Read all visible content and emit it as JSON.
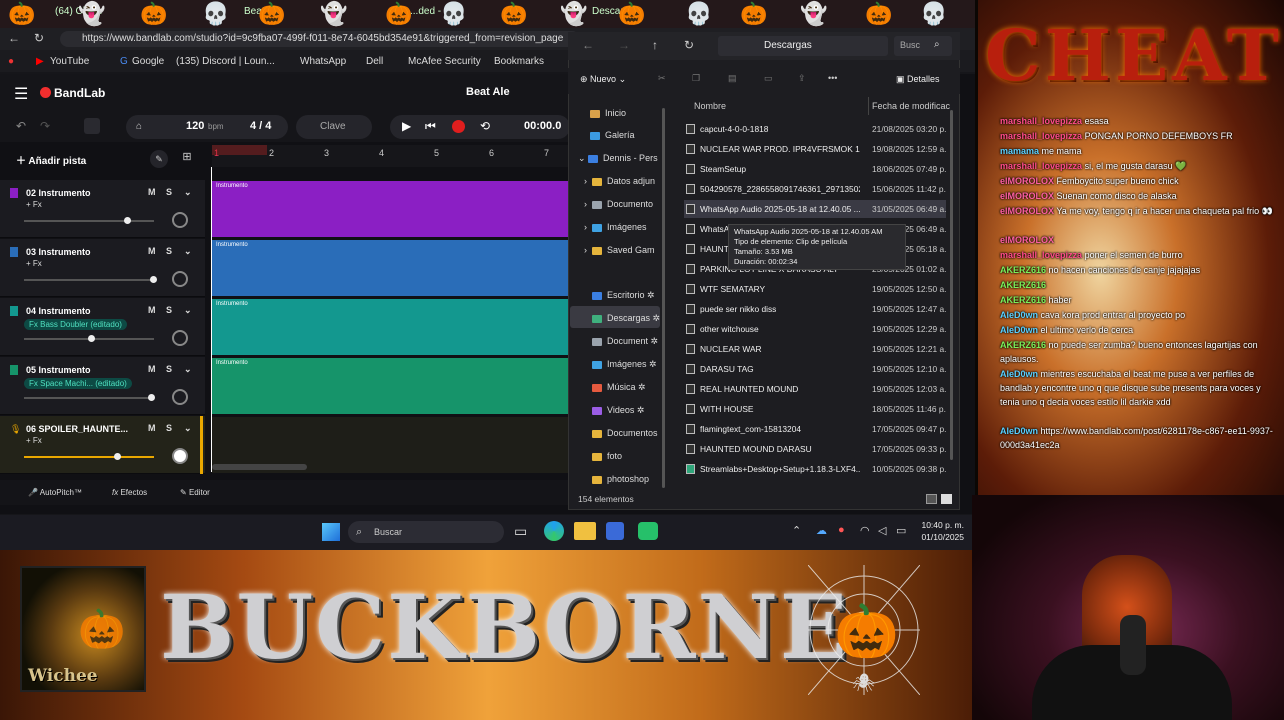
{
  "browser": {
    "tabs": [
      "(64) Cha...",
      "Beat Ale",
      "...ded -",
      "Descar..."
    ],
    "url": "https://www.bandlab.com/studio?id=9c9fba07-499f-f011-8e74-6045bd354e91&triggered_from=revision_page",
    "bookmarks": [
      "YouTube",
      "Google",
      "(135) Discord | Loun...",
      "WhatsApp",
      "Dell",
      "McAfee Security",
      "Bookmarks"
    ]
  },
  "bandlab": {
    "logo": "BandLab",
    "project": "Beat Ale",
    "bpm": "120",
    "bpm_unit": "bpm",
    "meter": "4 / 4",
    "key": "Clave",
    "time": "00:00.0",
    "add_track": "Añadir pista",
    "ruler": [
      "1",
      "2",
      "3",
      "4",
      "5",
      "6",
      "7"
    ],
    "tracks": [
      {
        "name": "02  Instrumento",
        "fx": "+ Fx",
        "fx_pill": "",
        "clip": "Instrumento",
        "color": "#8b1fc4",
        "vol": 0.75
      },
      {
        "name": "03  Instrumento",
        "fx": "+ Fx",
        "fx_pill": "",
        "clip": "Instrumento",
        "color": "#2a6db8",
        "vol": 0.9
      },
      {
        "name": "04  Instrumento",
        "fx": "",
        "fx_pill": "Fx Bass Doubler (editado)",
        "clip": "Instrumento",
        "color": "#13988f",
        "vol": 0.5
      },
      {
        "name": "05  Instrumento",
        "fx": "",
        "fx_pill": "Fx Space Machi... (editado)",
        "clip": "Instrumento",
        "color": "#16946a",
        "vol": 0.95
      },
      {
        "name": "06  SPOILER_HAUNTE...",
        "fx": "+ Fx",
        "fx_pill": "",
        "clip": "",
        "color": "#2a2a22",
        "vol": 0.7
      }
    ],
    "m_label": "M",
    "s_label": "S",
    "footer": [
      "AutoPitch™",
      "Efectos",
      "Editor"
    ]
  },
  "explorer": {
    "path": "Descargas",
    "search": "Busc",
    "new_label": "Nuevo",
    "details_label": "Detalles",
    "col_name": "Nombre",
    "col_date": "Fecha de modificaci",
    "sidebar": [
      "Inicio",
      "Galería",
      "Dennis - Pers",
      "Datos adjun",
      "Documento",
      "Imágenes",
      "Saved Gam",
      "Escritorio",
      "Descargas",
      "Document",
      "Imágenes",
      "Música",
      "Videos",
      "Documentos",
      "foto",
      "photoshop"
    ],
    "files": [
      {
        "name": "capcut-4-0-0-1818",
        "date": "21/08/2025 03:20 p."
      },
      {
        "name": "NUCLEAR WAR PROD. IPR4VFRSMOK 160...",
        "date": "19/08/2025 12:59 a."
      },
      {
        "name": "SteamSetup",
        "date": "18/06/2025 07:49 p."
      },
      {
        "name": "504290578_2286558091746361_297135021...",
        "date": "15/06/2025 11:42 p."
      },
      {
        "name": "WhatsApp Audio 2025-05-18 at 12.40.05 ...",
        "date": "31/05/2025 06:49 a."
      },
      {
        "name": "WhatsA",
        "date": "31/05/2025 06:49 a."
      },
      {
        "name": "HAUNT",
        "date": "31/05/2025 05:18 a."
      },
      {
        "name": "PARKING LOT LINE X DARASU ALT",
        "date": "25/05/2025 01:02 a."
      },
      {
        "name": "WTF SEMATARY",
        "date": "19/05/2025 12:50 a."
      },
      {
        "name": "puede ser nikko diss",
        "date": "19/05/2025 12:47 a."
      },
      {
        "name": "other witchouse",
        "date": "19/05/2025 12:29 a."
      },
      {
        "name": "NUCLEAR WAR",
        "date": "19/05/2025 12:21 a."
      },
      {
        "name": "DARASU TAG",
        "date": "19/05/2025 12:10 a."
      },
      {
        "name": "REAL HAUNTED MOUND",
        "date": "19/05/2025 12:03 a."
      },
      {
        "name": "WITH HOUSE",
        "date": "18/05/2025 11:46 p."
      },
      {
        "name": "flamingtext_com-15813204",
        "date": "17/05/2025 09:47 p."
      },
      {
        "name": "HAUNTED MOUND DARASU",
        "date": "17/05/2025 09:33 p."
      },
      {
        "name": "Streamlabs+Desktop+Setup+1.18.3-LXF4...",
        "date": "10/05/2025 09:38 p."
      }
    ],
    "tooltip": [
      "WhatsApp Audio 2025-05-18 at 12.40.05 AM",
      "Tipo de elemento: Clip de película",
      "Tamaño: 3.53 MB",
      "Duración: 00:02:34"
    ],
    "count": "154 elementos"
  },
  "taskbar": {
    "search": "Buscar",
    "time": "10:40 p. m.",
    "date": "01/10/2025"
  },
  "chat": {
    "title": "CHEAT",
    "messages": [
      {
        "user": "marshall_lovepizza",
        "text": "esasa",
        "cls": "u"
      },
      {
        "user": "marshall_lovepizza",
        "text": "PONGAN PORNO DEFEMBOYS FR",
        "cls": "u"
      },
      {
        "user": "mamama",
        "text": "me mama",
        "cls": "u3"
      },
      {
        "user": "marshall_lovepizza",
        "text": "si, el me gusta darasu 💚",
        "cls": "u"
      },
      {
        "user": "elMOROLOX",
        "text": "Femboycito super bueno chick",
        "cls": "u2"
      },
      {
        "user": "elMOROLOX",
        "text": "Suenan como disco de alaska",
        "cls": "u2"
      },
      {
        "user": "elMOROLOX",
        "text": "Ya me voy, tengo q ir a hacer una chaqueta pal frio 👀",
        "cls": "u2"
      },
      {
        "user": "elMOROLOX",
        "text": "",
        "cls": "u2"
      },
      {
        "user": "marshall_lovepizza",
        "text": "poner el semen de burro",
        "cls": "u"
      },
      {
        "user": "AKERZ616",
        "text": "no hacen canciones de canje jajajajas",
        "cls": "u4"
      },
      {
        "user": "AKERZ616",
        "text": "",
        "cls": "u4"
      },
      {
        "user": "AKERZ616",
        "text": "haber",
        "cls": "u4"
      },
      {
        "user": "AleD0wn",
        "text": "cava kora prod entrar al proyecto po",
        "cls": "u3"
      },
      {
        "user": "AleD0wn",
        "text": "el ultimo verlo de cerca",
        "cls": "u3"
      },
      {
        "user": "AKERZ616",
        "text": "no puede ser zumba? bueno entonces lagartijas con aplausos.",
        "cls": "u4"
      },
      {
        "user": "AleD0wn",
        "text": "mientres escuchaba el beat me puse a ver perfiles de bandlab y encontre uno q que disque sube presents para voces y tenia uno q decia voces estilo lil darkie xdd",
        "cls": "u3"
      },
      {
        "user": "AleD0wn",
        "text": "https://www.bandlab.com/post/6281178e-c867-ee11-9937-000d3a41ec2a",
        "cls": "u3"
      }
    ]
  },
  "overlay": {
    "left_logo_text": "Wichee",
    "banner_text": "BUCKBORNE"
  }
}
